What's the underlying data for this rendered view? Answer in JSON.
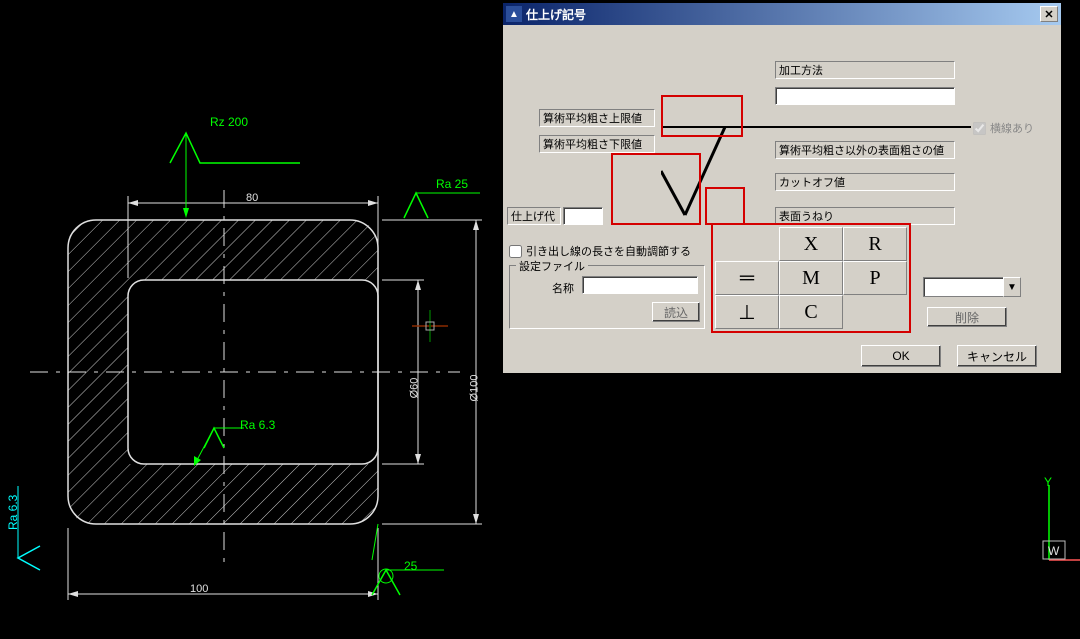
{
  "cad": {
    "rz200": "Rz 200",
    "ra25": "Ra 25",
    "ra63": "Ra 6.3",
    "ra63_left": "Ra 6.3",
    "dim80": "80",
    "dim100": "100",
    "dim25": "25",
    "d60": "Ø60",
    "d100": "Ø100",
    "axis_y": "Y",
    "axis_w": "W"
  },
  "dialog": {
    "title": "仕上げ記号",
    "proc_method": "加工方法",
    "upper": "算術平均粗さ上限値",
    "lower": "算術平均粗さ下限値",
    "finish_allow": "仕上げ代",
    "other_rough": "算術平均粗さ以外の表面粗さの値",
    "cutoff": "カットオフ値",
    "waviness": "表面うねり",
    "leader_chk": "引き出し線の長さを自動調節する",
    "has_line": "横線あり",
    "settings_file": "設定ファイル",
    "name_lbl": "名称",
    "load": "読込",
    "delete": "削除",
    "ok": "OK",
    "cancel": "キャンセル",
    "sym": {
      "x": "X",
      "r": "R",
      "m": "M",
      "p": "P",
      "c": "C"
    }
  }
}
